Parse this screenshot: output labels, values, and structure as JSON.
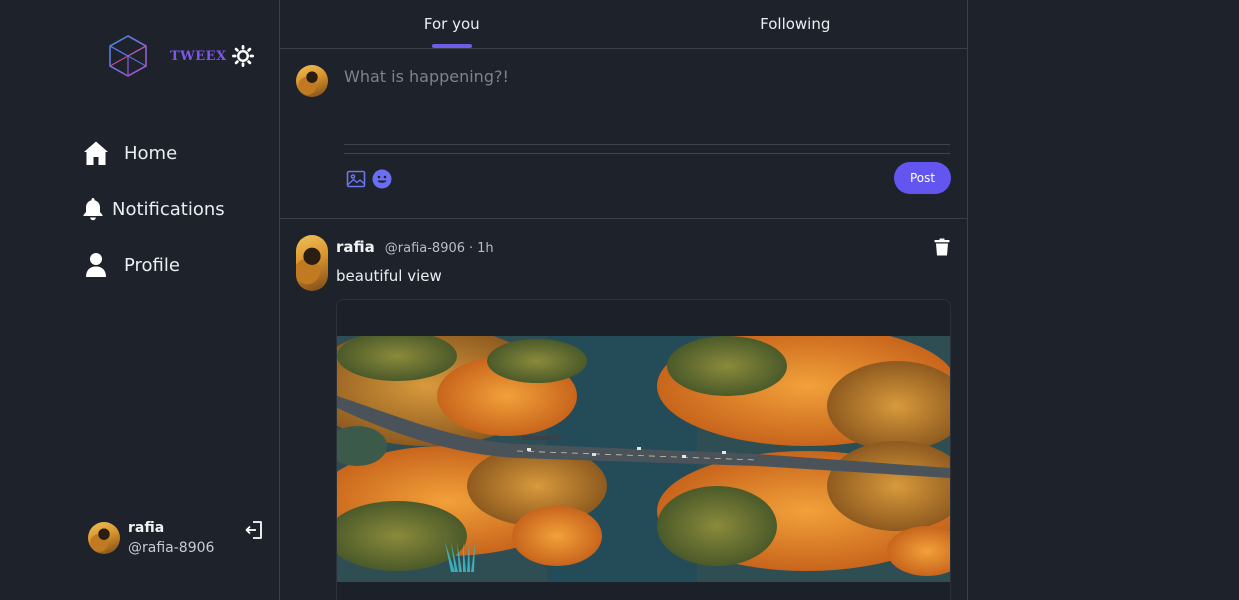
{
  "brand": {
    "name": "TWEEX",
    "icon": "hexagon-cube-logo"
  },
  "theme": {
    "icon": "sun-icon"
  },
  "nav": {
    "items": [
      {
        "label": "Home",
        "icon": "home-icon"
      },
      {
        "label": "Notifications",
        "icon": "bell-icon"
      },
      {
        "label": "Profile",
        "icon": "user-icon"
      }
    ]
  },
  "current_user": {
    "name": "rafia",
    "handle": "@rafia-8906",
    "logout_icon": "logout-icon"
  },
  "tabs": [
    {
      "label": "For you",
      "active": true
    },
    {
      "label": "Following",
      "active": false
    }
  ],
  "composer": {
    "placeholder": "What is happening?!",
    "value": "",
    "tools": [
      "image-icon",
      "emoji-icon"
    ],
    "post_label": "Post"
  },
  "feed": [
    {
      "name": "rafia",
      "handle": "@rafia-8906",
      "separator": "·",
      "time": "1h",
      "text": "beautiful view",
      "media": "aerial-autumn-forest-photo",
      "delete_icon": "trash-icon"
    }
  ],
  "colors": {
    "accent": "#6c5ce7",
    "post_button": "#6355f0",
    "brand": "#7e57e6",
    "background": "#1d222b"
  }
}
